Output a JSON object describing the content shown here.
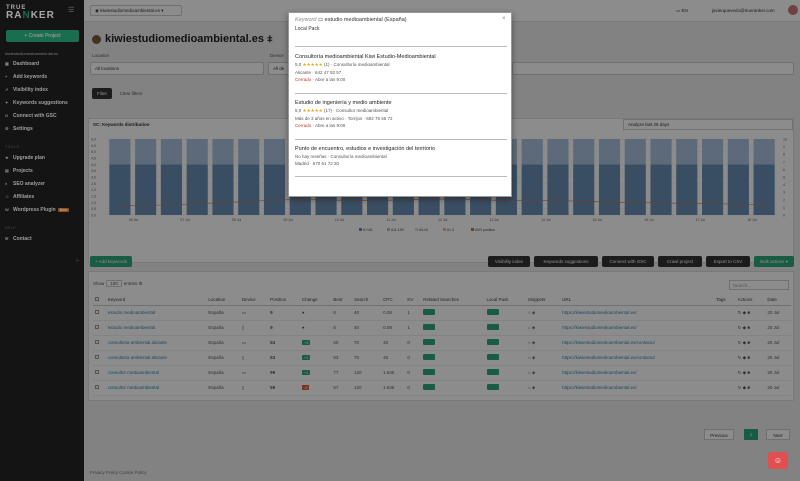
{
  "sidebar": {
    "logo_line1": "TRUE",
    "logo_line2a": "RA",
    "logo_line2b": "N",
    "logo_line2c": "KER",
    "create_label": "+ Create Project",
    "project": "kiwiestudiomedioambiental.es",
    "items": [
      {
        "label": "Dashboard"
      },
      {
        "label": "Add keywords"
      },
      {
        "label": "Visibility index"
      },
      {
        "label": "Keywords suggestions"
      },
      {
        "label": "Connect with GSC"
      },
      {
        "label": "Settings"
      }
    ],
    "tools_head": "TOOLS",
    "tools": [
      {
        "label": "Upgrade plan"
      },
      {
        "label": "Projects"
      },
      {
        "label": "SEO analyzer"
      },
      {
        "label": "Affiliates"
      },
      {
        "label": "Wordpress Plugin",
        "badge": "New"
      }
    ],
    "help_head": "HELP",
    "help": [
      {
        "label": "Contact"
      }
    ]
  },
  "topbar": {
    "domain": "kiwiestudiomedioambiental.es",
    "lang": "EN",
    "email": "javierquevedo@trueranker.com"
  },
  "main": {
    "title": "kiwiestudiomedioambiental.es",
    "location_label": "Location",
    "location_value": "All locations",
    "device_label": "Device",
    "device_value": "All de",
    "filter_btn": "Filter",
    "clear_btn": "Clear filters",
    "chart_title": "SC: Keywords distribution",
    "period": "Analyze last 28 days"
  },
  "chart_data": {
    "type": "bar",
    "categories": [
      "06 Jul",
      "07 Jul",
      "08 Jul",
      "09 Jul",
      "10 Jul",
      "11 Jul",
      "12 Jul",
      "13 Jul",
      "14 Jul",
      "15 Jul",
      "16 Jul",
      "17 Jul",
      "18 Jul"
    ],
    "y_ticks_left": [
      "6,0",
      "5,5",
      "5,0",
      "4,5",
      "4,0",
      "3,5",
      "3,0",
      "2,5",
      "2,0",
      "1,5",
      "1,0",
      "0,5",
      "0,0"
    ],
    "y_ticks_right": [
      "10",
      "9",
      "8",
      "7",
      "6",
      "5",
      "4",
      "3",
      "2",
      "1",
      "0"
    ],
    "series": [
      {
        "name": "#>101",
        "values": [
          4,
          4,
          4,
          4,
          4,
          4,
          4,
          4,
          4,
          4,
          4,
          4,
          4,
          4,
          4,
          4,
          4,
          4,
          4,
          4,
          4,
          4,
          4,
          4,
          4,
          4
        ]
      },
      {
        "name": "#11-100",
        "values": [
          2,
          2,
          2,
          2,
          2,
          2,
          2,
          2,
          2,
          2,
          2,
          2,
          2,
          2,
          2,
          2,
          2,
          2,
          2,
          2,
          2,
          2,
          2,
          2,
          2,
          2
        ]
      },
      {
        "name": "#4-10",
        "values": [
          0,
          0,
          0,
          0,
          0,
          0,
          0,
          0,
          0,
          0,
          0,
          0,
          0,
          0,
          0,
          0,
          0,
          0,
          0,
          0,
          0,
          0,
          0,
          0,
          0,
          0
        ]
      },
      {
        "name": "#1-3",
        "values": [
          0,
          0,
          0,
          0,
          0,
          0,
          0,
          0,
          0,
          0,
          0,
          0,
          0,
          0,
          0,
          0,
          0,
          0,
          0,
          0,
          0,
          0,
          0,
          0,
          0,
          0
        ]
      }
    ],
    "legend_extra": "AVG position",
    "legend_placement": "bottom",
    "avg_position": [
      1.2,
      1.3,
      1.3,
      1.5,
      1.6,
      1.8,
      2.0,
      2.0,
      2.0,
      1.9,
      1.9,
      2.0,
      2.1,
      2.1,
      2.0,
      1.9,
      1.9,
      1.9,
      1.8,
      1.7,
      1.6,
      1.6,
      1.5,
      1.5,
      1.4,
      1.3
    ],
    "ylim_left": [
      0,
      6
    ],
    "ylim_right": [
      0,
      10
    ],
    "colors": {
      "bar_dark": "#6b8fb5",
      "bar_light": "#a9c2dc",
      "line": "#c07850"
    }
  },
  "actions": {
    "add_keywords": "+ Add keywords",
    "visibility": "Visibility index",
    "suggestions": "Keywords suggestions",
    "gsc": "Connect with GSC",
    "crawl": "Crawl project",
    "export": "Export to CSV",
    "bulk": "Bulk actions ▾"
  },
  "table": {
    "show_label": "Show",
    "show_value": "100",
    "entries_label": "entries",
    "search_placeholder": "Search...",
    "headers": [
      "",
      "Keyword",
      "Location",
      "Device",
      "Position",
      "Change",
      "Best",
      "Search",
      "CPC",
      "KV",
      "Related Searches",
      "Local Pack",
      "Snippets",
      "URL",
      "Tags",
      "Actions",
      "Date"
    ],
    "rows": [
      {
        "kw": "estudio medioambiental",
        "loc": "España",
        "dev": "desktop",
        "pos": "9",
        "chg": "",
        "best": "6",
        "search": "40",
        "cpc": "0.08",
        "kv": "1",
        "url": "https://kiwiestudiomedioambiental.es/",
        "date": "20 Jul"
      },
      {
        "kw": "estudio medioambiental",
        "loc": "España",
        "dev": "mobile",
        "pos": "9",
        "chg": "",
        "best": "6",
        "search": "40",
        "cpc": "0.08",
        "kv": "1",
        "url": "https://kiwiestudiomedioambiental.es/",
        "date": "20 Jul"
      },
      {
        "kw": "consultoria ambiental alicante",
        "loc": "España",
        "dev": "desktop",
        "pos": "53",
        "chg": "+3",
        "best": "50",
        "search": "70",
        "cpc": "40",
        "kv": "0",
        "url": "https://kiwiestudiomedioambiental.es/contacto/",
        "date": "20 Jul"
      },
      {
        "kw": "consultoria ambiental alicante",
        "loc": "España",
        "dev": "mobile",
        "pos": "53",
        "chg": "+2",
        "best": "53",
        "search": "70",
        "cpc": "40",
        "kv": "0",
        "url": "https://kiwiestudiomedioambiental.es/contacto/",
        "date": "20 Jul"
      },
      {
        "kw": "consultor medioambiental",
        "loc": "España",
        "dev": "desktop",
        "pos": "99",
        "chg": "+1",
        "best": "77",
        "search": "120",
        "cpc": "1.54€",
        "kv": "0",
        "url": "https://kiwiestudiomedioambiental.es/",
        "date": "20 Jul"
      },
      {
        "kw": "consultor medioambiental",
        "loc": "España",
        "dev": "mobile",
        "pos": "59",
        "chg": "-9",
        "best": "57",
        "search": "120",
        "cpc": "1.54€",
        "kv": "0",
        "url": "https://kiwiestudiomedioambiental.es/",
        "date": "20 Jul"
      }
    ]
  },
  "pager": {
    "prev": "Previous",
    "page": "1",
    "next": "Next"
  },
  "footer": {
    "privacy": "Privacy Policy",
    "cookie": "Cookie Policy"
  },
  "modal": {
    "keyword_label": "Keyword",
    "keyword": "estudio medioambiental (España)",
    "subtitle": "Local Pack",
    "close": "×",
    "results": [
      {
        "name": "Consultoría medioambiental Kiwi Estudio-Medioambiental",
        "rating": "5,0",
        "stars": "★★★★★",
        "count": "(1)",
        "type": "· Consultoría medioambiental",
        "line2": "Alicante · 642 47 93 57",
        "closed": "Cerrado",
        "opens": "· Abre a las 9:00"
      },
      {
        "name": "Estudio de ingeniería y medio ambiente",
        "rating": "5,0",
        "stars": "★★★★★",
        "count": "(17)",
        "type": "· Consultor medioambiental",
        "line2": "Más de 3 años en activo · Torrijos · 692 75 66 72",
        "closed": "Cerrado",
        "opens": "· Abre a las 9:00"
      },
      {
        "name": "Punto de encuentro, estudios e investigación del territorio",
        "rating": "",
        "stars": "",
        "count": "No hay reseñas",
        "type": "· Consultoría medioambiental",
        "line2": "Madrid · 670 61 72 30",
        "closed": "",
        "opens": ""
      }
    ]
  }
}
